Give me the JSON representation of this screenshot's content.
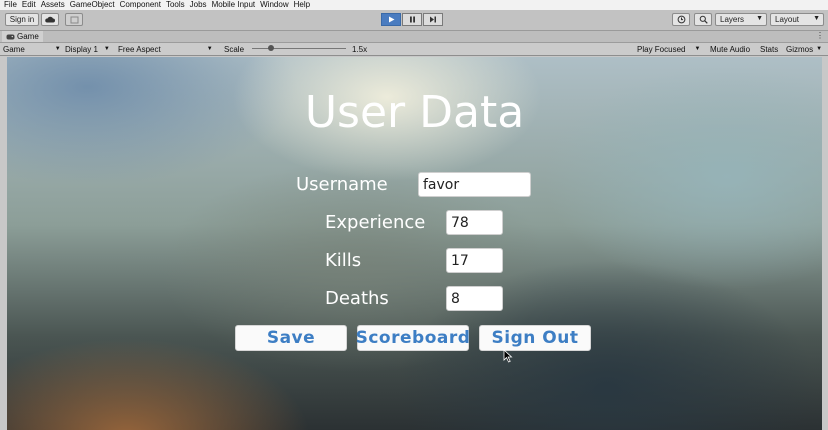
{
  "menu": [
    "File",
    "Edit",
    "Assets",
    "GameObject",
    "Component",
    "Tools",
    "Jobs",
    "Mobile Input",
    "Window",
    "Help"
  ],
  "toolbar": {
    "sign_in": "Sign in",
    "layers": "Layers",
    "layout": "Layout"
  },
  "tab": {
    "label": "Game"
  },
  "gamebar": {
    "mode": "Game",
    "display": "Display 1",
    "aspect": "Free Aspect",
    "scale_label": "Scale",
    "scale_value": "1.5x",
    "play_focused": "Play Focused",
    "mute_audio": "Mute Audio",
    "stats": "Stats",
    "gizmos": "Gizmos"
  },
  "form": {
    "title": "User Data",
    "username_label": "Username",
    "username_value": "favor",
    "experience_label": "Experience",
    "experience_value": "78",
    "kills_label": "Kills",
    "kills_value": "17",
    "deaths_label": "Deaths",
    "deaths_value": "8"
  },
  "buttons": {
    "save": "Save",
    "scoreboard": "Scoreboard",
    "sign_out": "Sign Out"
  },
  "colors": {
    "button_text": "#3d7ec4",
    "play_active": "#4a7cc0"
  }
}
